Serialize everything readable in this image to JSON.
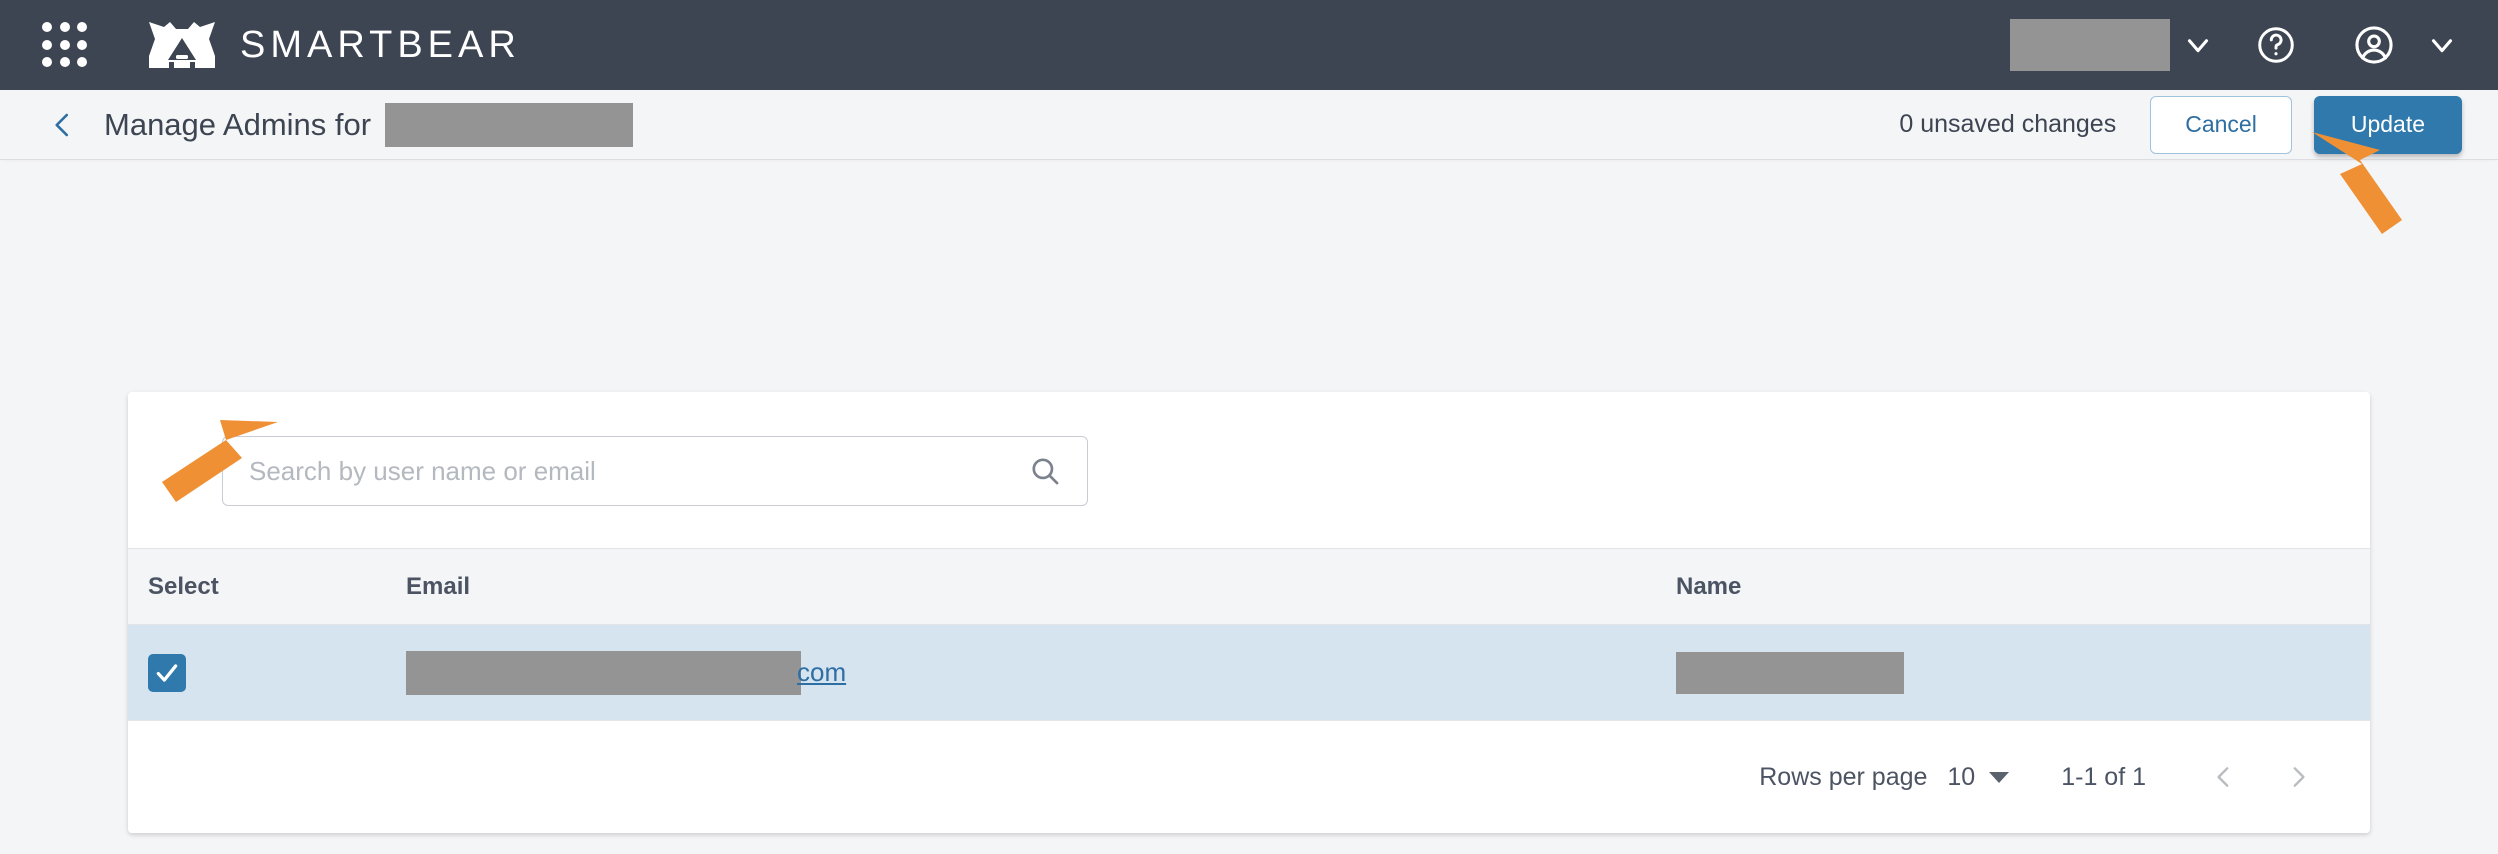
{
  "topnav": {
    "app_launcher_icon": "app-grid-icon",
    "brand_mark_icon": "smartbear-bear-logo",
    "brand_name": "SMARTBEAR",
    "org_redacted": "",
    "org_chevron_icon": "chevron-down-icon",
    "help_icon": "help-circle-icon",
    "account_icon": "user-circle-icon",
    "account_chevron_icon": "chevron-down-icon"
  },
  "header": {
    "back_icon": "chevron-left-icon",
    "title": "Manage Admins for",
    "title_target_redacted": "",
    "unsaved_changes": "0 unsaved changes",
    "cancel_label": "Cancel",
    "update_label": "Update"
  },
  "search": {
    "placeholder": "Search by user name or email",
    "value": "",
    "icon": "search-icon"
  },
  "table": {
    "columns": [
      {
        "key": "select",
        "label": "Select"
      },
      {
        "key": "email",
        "label": "Email"
      },
      {
        "key": "name",
        "label": "Name"
      }
    ],
    "rows": [
      {
        "selected": true,
        "checkbox_icon": "check-icon",
        "email_redacted": "",
        "email_suffix": "com",
        "name_redacted": ""
      }
    ]
  },
  "pagination": {
    "rows_per_page_label": "Rows per page",
    "rows_per_page_value": "10",
    "rows_per_page_caret_icon": "caret-down-icon",
    "range_label": "1-1 of 1",
    "prev_icon": "chevron-left-icon",
    "next_icon": "chevron-right-icon"
  },
  "annotations": {
    "arrow_color": "#ef9035",
    "arrow_to_update": "arrow-pointing-to-update-button",
    "arrow_to_checkbox": "arrow-pointing-to-row-checkbox"
  },
  "colors": {
    "nav_bg": "#3d4552",
    "page_bg": "#f4f5f7",
    "primary_blue": "#2f79ad",
    "link_blue": "#2d6ea3",
    "selected_row": "#d6e4ef",
    "redaction_gray": "#949494",
    "accent_orange": "#ef9035"
  }
}
